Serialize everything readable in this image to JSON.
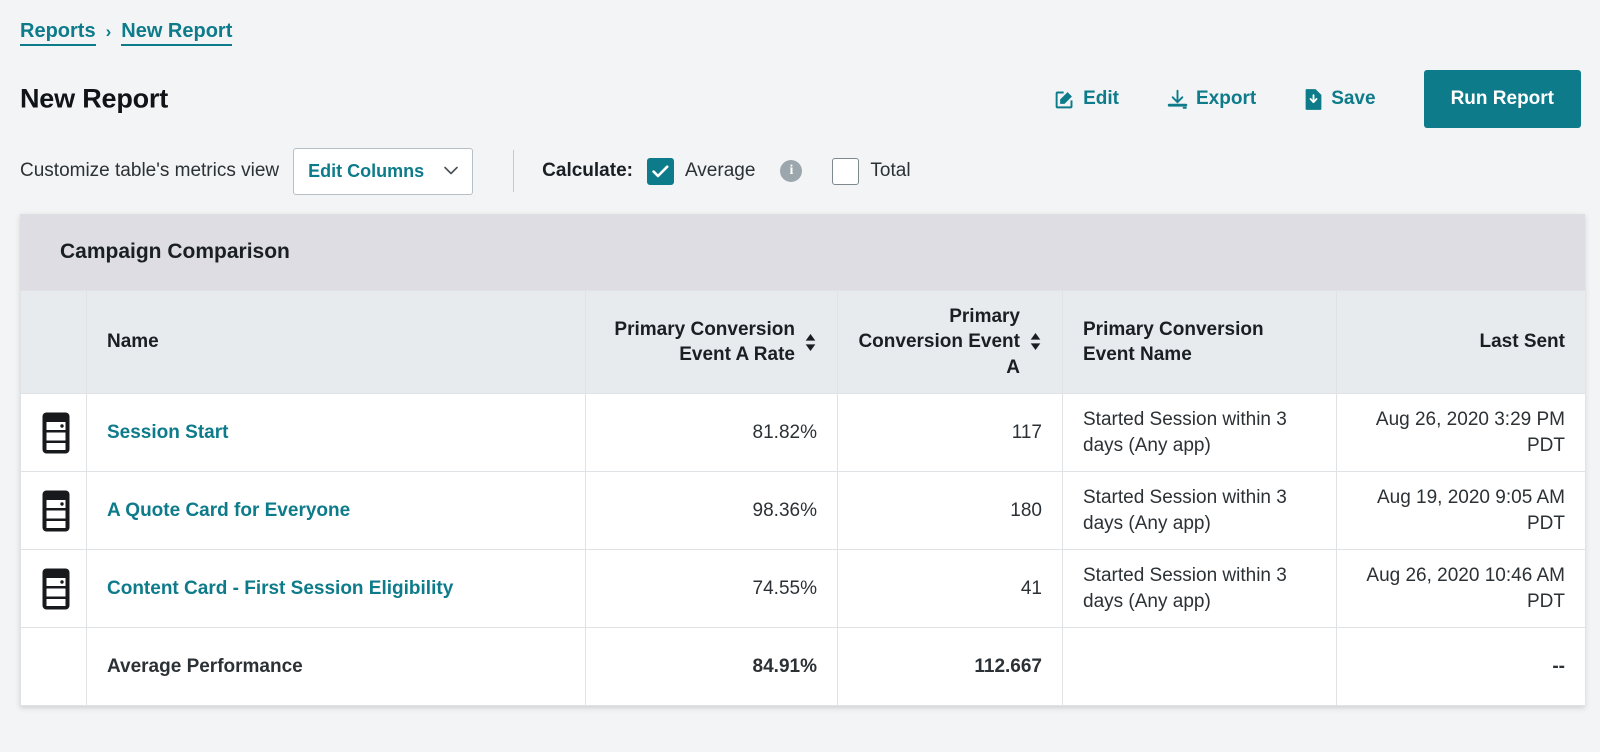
{
  "breadcrumb": {
    "items": [
      {
        "label": "Reports"
      },
      {
        "label": "New Report"
      }
    ],
    "separator": "›"
  },
  "header": {
    "title": "New Report",
    "actions": [
      {
        "label": "Edit",
        "icon": "edit-pencil-icon"
      },
      {
        "label": "Export",
        "icon": "download-tray-icon"
      },
      {
        "label": "Save",
        "icon": "file-save-icon"
      }
    ],
    "primary_button": {
      "label": "Run Report",
      "color": "#0d7b8a"
    }
  },
  "controls": {
    "customize_label": "Customize table's metrics view",
    "edit_columns": {
      "label": "Edit Columns",
      "icon": "chevron-down-icon"
    },
    "calculate_label": "Calculate:",
    "average": {
      "label": "Average",
      "checked": true
    },
    "info_icon": {
      "glyph": "i",
      "name": "info-icon"
    },
    "total": {
      "label": "Total",
      "checked": false
    }
  },
  "card": {
    "title": "Campaign Comparison"
  },
  "table": {
    "columns": [
      {
        "key": "icon",
        "label": "",
        "align": "center",
        "sortable": false
      },
      {
        "key": "name",
        "label": "Name",
        "align": "left",
        "sortable": false
      },
      {
        "key": "rate",
        "label": "Primary Conversion Event A Rate",
        "align": "right",
        "sortable": true
      },
      {
        "key": "count",
        "label": "Primary Conversion Event A",
        "align": "right",
        "sortable": true
      },
      {
        "key": "evname",
        "label": "Primary Conversion Event Name",
        "align": "left",
        "sortable": false
      },
      {
        "key": "sent",
        "label": "Last Sent",
        "align": "right",
        "sortable": false
      }
    ],
    "rows": [
      {
        "icon": "content-card-icon",
        "name": "Session Start",
        "rate": "81.82%",
        "count": "117",
        "evname": "Started Session within 3 days (Any app)",
        "sent": "Aug 26, 2020 3:29 PM PDT"
      },
      {
        "icon": "content-card-icon",
        "name": "A Quote Card for Everyone",
        "rate": "98.36%",
        "count": "180",
        "evname": "Started Session within 3 days (Any app)",
        "sent": "Aug 19, 2020 9:05 AM PDT"
      },
      {
        "icon": "content-card-icon",
        "name": "Content Card - First Session Eligibility",
        "rate": "74.55%",
        "count": "41",
        "evname": "Started Session within 3 days (Any app)",
        "sent": "Aug 26, 2020 10:46 AM PDT"
      }
    ],
    "summary": {
      "label": "Average Performance",
      "rate": "84.91%",
      "count": "112.667",
      "evname": "",
      "sent": "--"
    }
  },
  "colors": {
    "accent": "#0d7b8a",
    "page_bg": "#f3f4f6",
    "card_header_bg": "#dddde3",
    "table_header_bg": "#e7ebee",
    "text": "#1a1f24"
  }
}
